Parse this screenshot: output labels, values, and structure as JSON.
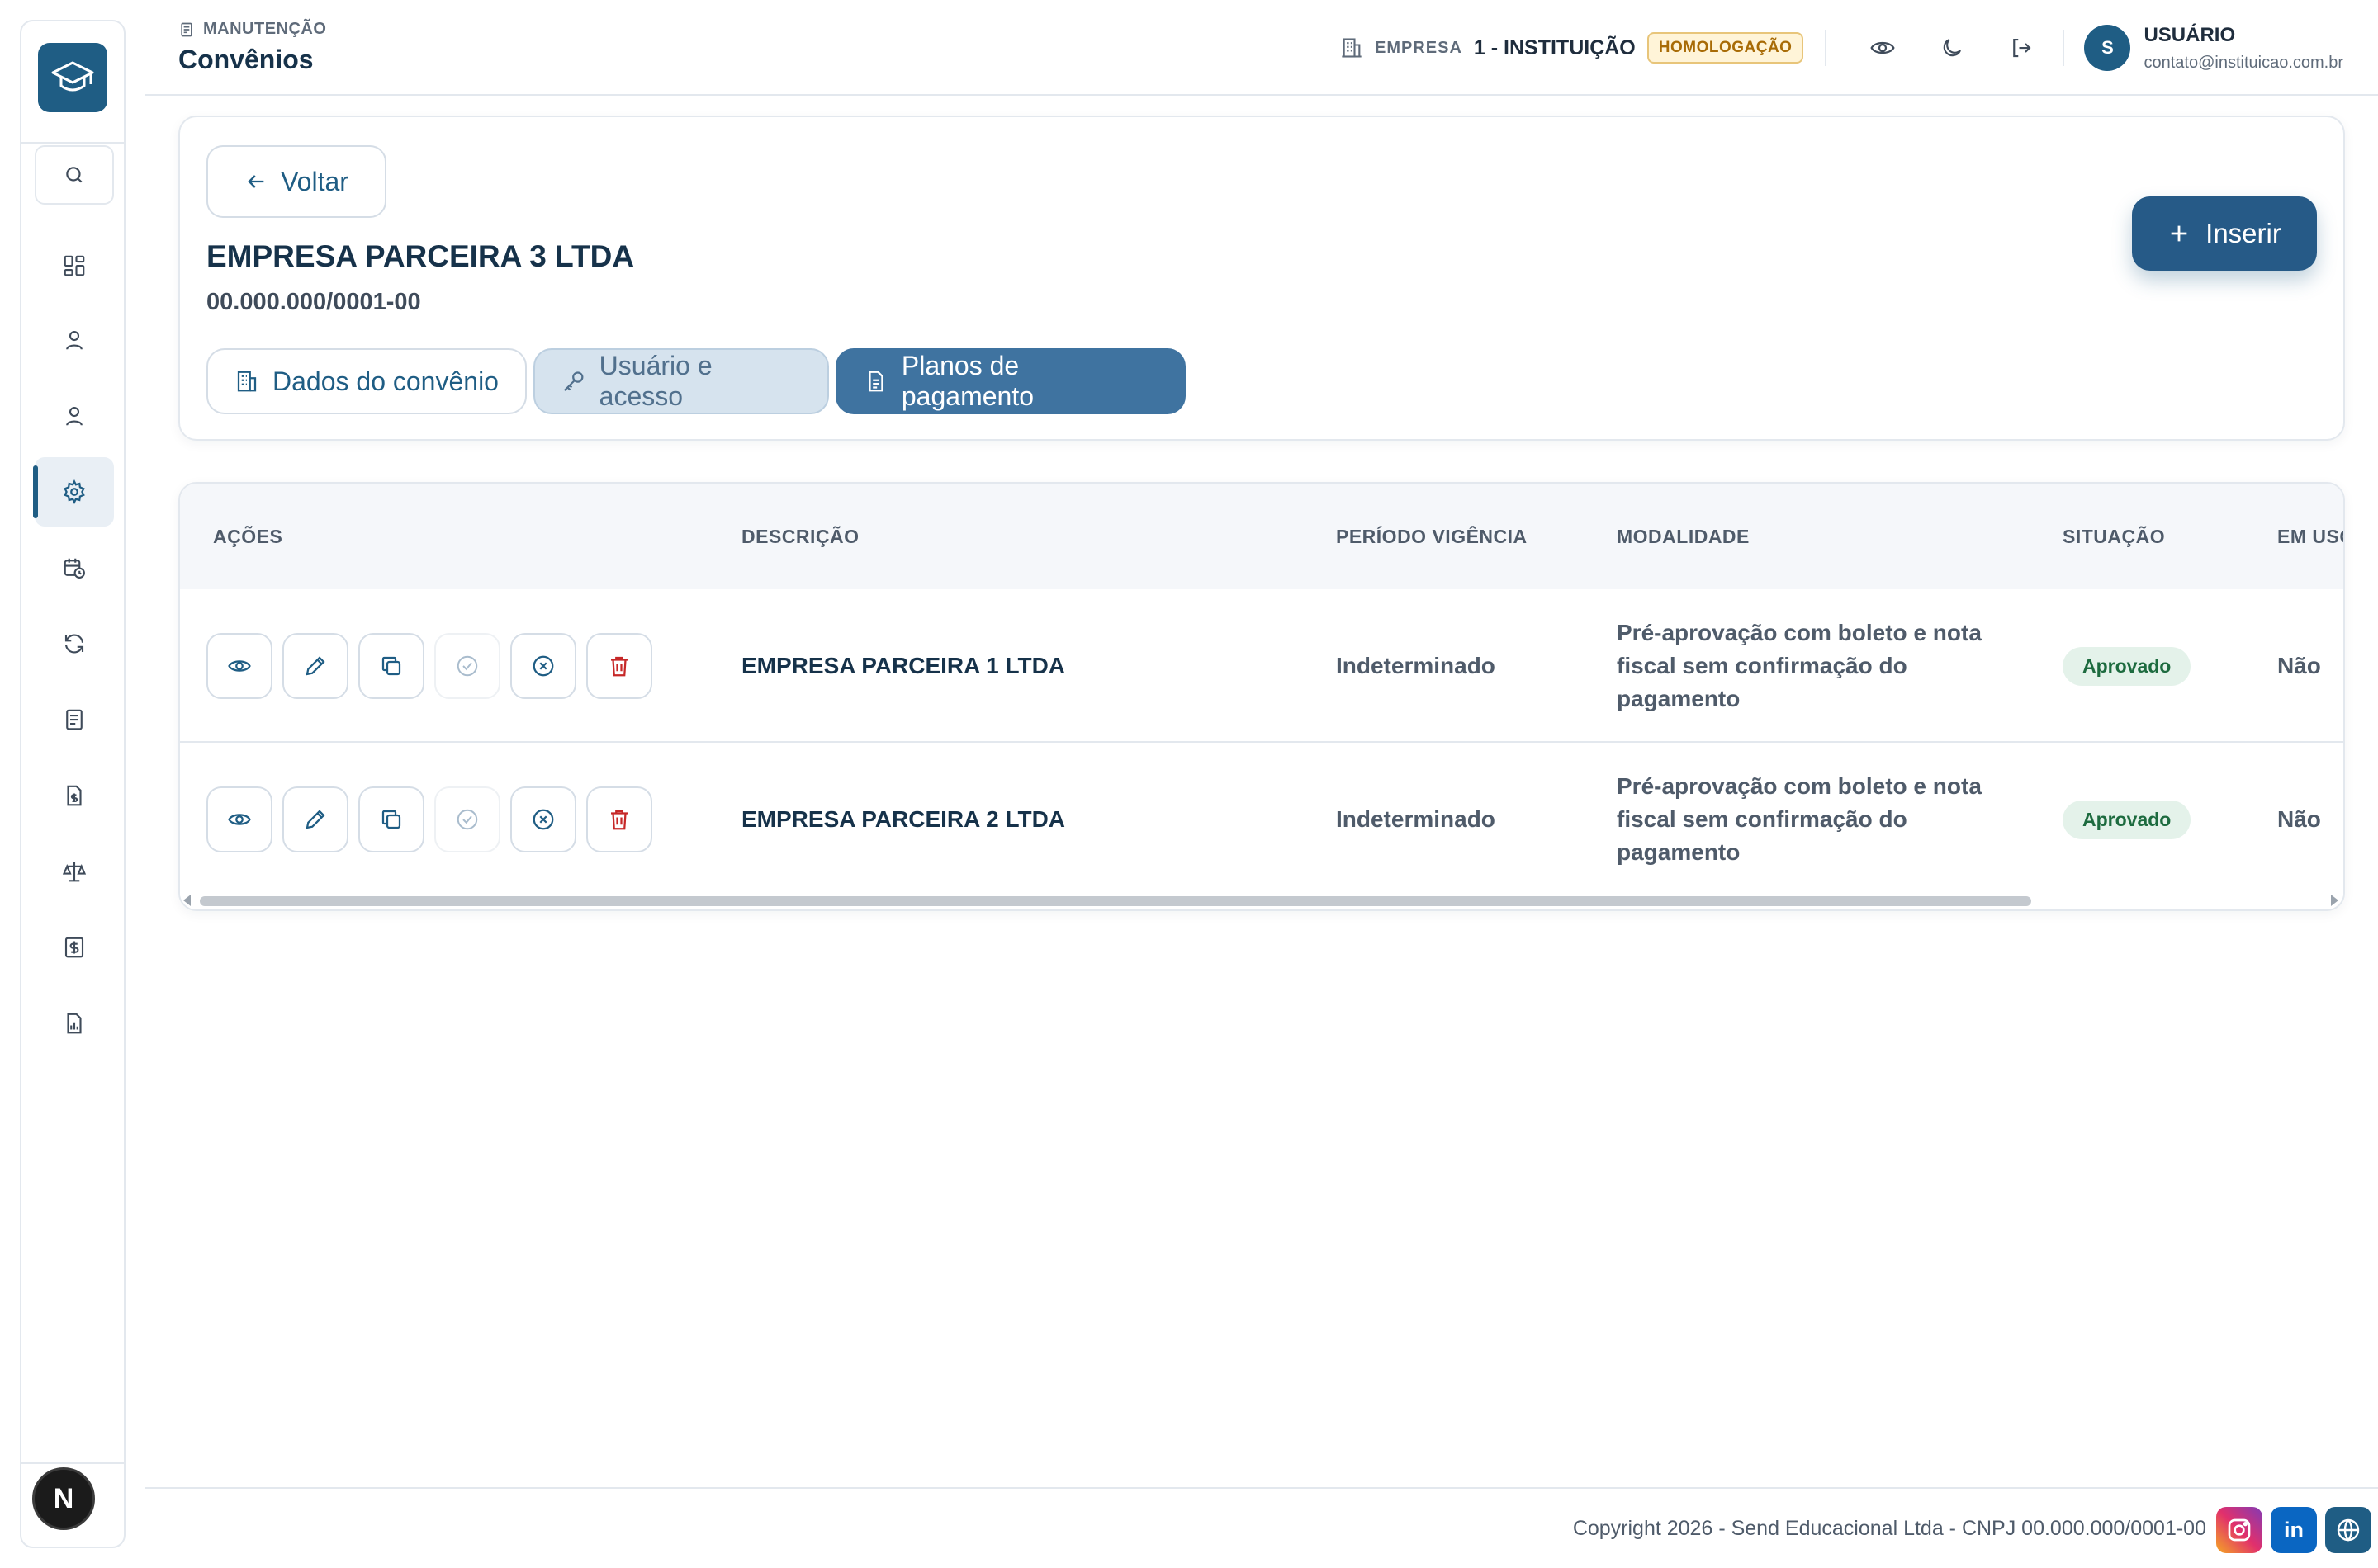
{
  "header": {
    "breadcrumb": "MANUTENÇÃO",
    "title": "Convênios",
    "company_label": "EMPRESA",
    "company_name": "1 - INSTITUIÇÃO",
    "environment": "HOMOLOGAÇÃO",
    "user": {
      "initial": "S",
      "name": "USUÁRIO",
      "email": "contato@instituicao.com.br"
    }
  },
  "sidebar": {
    "items": [
      {
        "icon": "dashboard-icon"
      },
      {
        "icon": "user-icon"
      },
      {
        "icon": "user-alt-icon"
      },
      {
        "icon": "settings-icon",
        "active": true
      },
      {
        "icon": "calendar-clock-icon"
      },
      {
        "icon": "refresh-icon"
      },
      {
        "icon": "document-icon"
      },
      {
        "icon": "file-dollar-icon"
      },
      {
        "icon": "scale-icon"
      },
      {
        "icon": "dollar-document-icon"
      },
      {
        "icon": "report-chart-icon"
      }
    ],
    "avatar": "N"
  },
  "card": {
    "back_label": "Voltar",
    "company_title": "EMPRESA PARCEIRA 3 LTDA",
    "cnpj": "00.000.000/0001-00",
    "tabs": [
      {
        "label": "Dados do convênio"
      },
      {
        "label": "Usuário e acesso"
      },
      {
        "label": "Planos de pagamento",
        "active": true
      }
    ],
    "insert_label": "Inserir"
  },
  "table": {
    "columns": [
      "AÇÕES",
      "DESCRIÇÃO",
      "PERÍODO VIGÊNCIA",
      "MODALIDADE",
      "SITUAÇÃO",
      "EM USO"
    ],
    "rows": [
      {
        "descricao": "EMPRESA PARCEIRA 1 LTDA",
        "periodo": "Indeterminado",
        "modalidade": "Pré-aprovação com boleto e nota fiscal sem confirmação do pagamento",
        "situacao": "Aprovado",
        "em_uso": "Não"
      },
      {
        "descricao": "EMPRESA PARCEIRA 2 LTDA",
        "periodo": "Indeterminado",
        "modalidade": "Pré-aprovação com boleto e nota fiscal sem confirmação do pagamento",
        "situacao": "Aprovado",
        "em_uso": "Não"
      }
    ]
  },
  "footer": {
    "copyright": "Copyright 2026 - Send Educacional Ltda - CNPJ 00.000.000/0001-00",
    "socials": [
      "instagram-icon",
      "linkedin-icon",
      "globe-icon"
    ],
    "linkedin_text": "in"
  },
  "colors": {
    "primary": "#1f5d84",
    "active_tab": "#3f73a0",
    "status_approved": "#1d6b3f",
    "danger": "#c62828",
    "env_badge": "#a86b06"
  }
}
